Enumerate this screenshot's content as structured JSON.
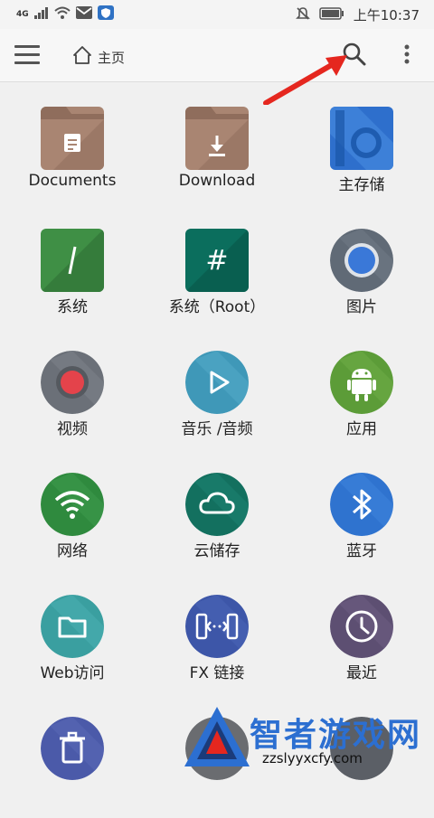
{
  "status": {
    "network": "4G",
    "time": "上午10:37"
  },
  "header": {
    "title": "主页"
  },
  "tiles": [
    {
      "label": "Documents",
      "icon": "folder-documents-icon",
      "color": "#a98572"
    },
    {
      "label": "Download",
      "icon": "folder-download-icon",
      "color": "#a98572"
    },
    {
      "label": "主存储",
      "icon": "internal-storage-icon",
      "color": "#2e6fcc"
    },
    {
      "label": "系统",
      "icon": "system-icon",
      "color": "#3f8f45"
    },
    {
      "label": "系统（Root）",
      "icon": "root-icon",
      "color": "#0b6e5d"
    },
    {
      "label": "图片",
      "icon": "pictures-icon",
      "color": "#606a76"
    },
    {
      "label": "视频",
      "icon": "video-icon",
      "color": "#6b7078"
    },
    {
      "label": "音乐 /音频",
      "icon": "music-icon",
      "color": "#3f98b8"
    },
    {
      "label": "应用",
      "icon": "apps-icon",
      "color": "#5c9c38"
    },
    {
      "label": "网络",
      "icon": "wifi-icon",
      "color": "#2f8a3e"
    },
    {
      "label": "云储存",
      "icon": "cloud-icon",
      "color": "#13705f"
    },
    {
      "label": "蓝牙",
      "icon": "bluetooth-icon",
      "color": "#2f73cf"
    },
    {
      "label": "Web访问",
      "icon": "web-folder-icon",
      "color": "#3a9fa0"
    },
    {
      "label": "FX 链接",
      "icon": "fx-connect-icon",
      "color": "#3d56a8"
    },
    {
      "label": "最近",
      "icon": "clock-icon",
      "color": "#5d4f72"
    },
    {
      "label": "",
      "icon": "trash-icon",
      "color": "#4b5aa9"
    },
    {
      "label": "",
      "icon": "partial-icon",
      "color": "#6a6c70"
    },
    {
      "label": "",
      "icon": "help-icon",
      "color": "#5b5f66"
    }
  ],
  "watermark": {
    "title": "智者游戏网",
    "site": "zzslyyxcfy.com"
  }
}
